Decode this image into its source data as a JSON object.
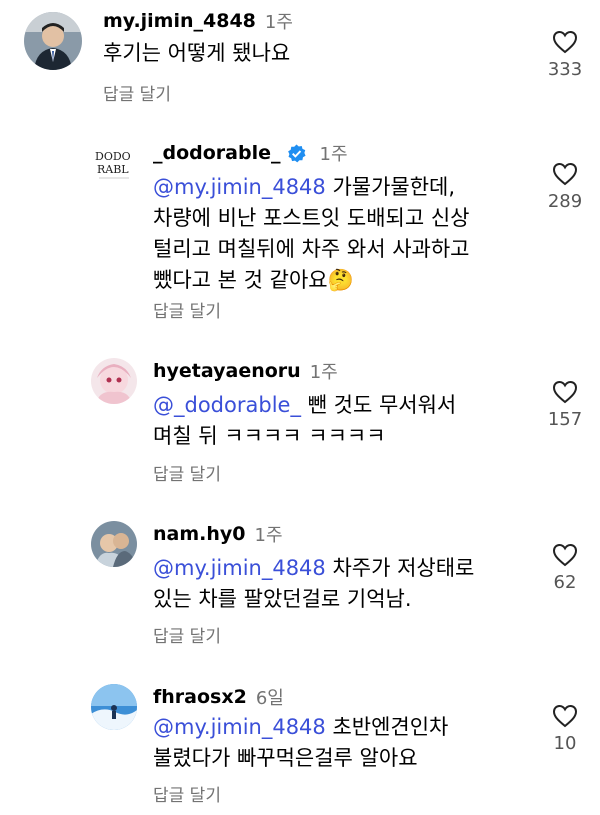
{
  "comment": {
    "username": "my.jimin_4848",
    "time": "1주",
    "text": "후기는 어떻게 됐나요",
    "reply_label": "답글 달기",
    "likes": "333"
  },
  "replies": [
    {
      "username": "_dodorable_",
      "time": "1주",
      "verified": true,
      "mention": "@my.jimin_4848",
      "lines": [
        " 가물가물한데,",
        "차량에 비난 포스트잇 도배되고 신상",
        "털리고 며칠뒤에 차주 와서 사과하고",
        "뺐다고 본 것 같아요🤔"
      ],
      "reply_label": "답글 달기",
      "likes": "289"
    },
    {
      "username": "hyetayaenoru",
      "time": "1주",
      "mention": "@_dodorable_",
      "lines": [
        " 뺀 것도 무서워서",
        "며칠 뒤 ㅋㅋㅋㅋ ㅋㅋㅋㅋ"
      ],
      "reply_label": "답글 달기",
      "likes": "157"
    },
    {
      "username": "nam.hy0",
      "time": "1주",
      "mention": "@my.jimin_4848",
      "lines": [
        " 차주가 저상태로",
        "있는 차를 팔았던걸로 기억남."
      ],
      "reply_label": "답글 달기",
      "likes": "62"
    },
    {
      "username": "fhraosx2",
      "time": "6일",
      "mention": "@my.jimin_4848",
      "lines": [
        " 초반엔견인차",
        "불렸다가 빠꾸먹은걸루 알아요"
      ],
      "reply_label": "답글 달기",
      "likes": "10"
    }
  ],
  "colors": {
    "mention": "#3a4fd8",
    "meta": "#737373",
    "verified": "#1f8ef1"
  }
}
